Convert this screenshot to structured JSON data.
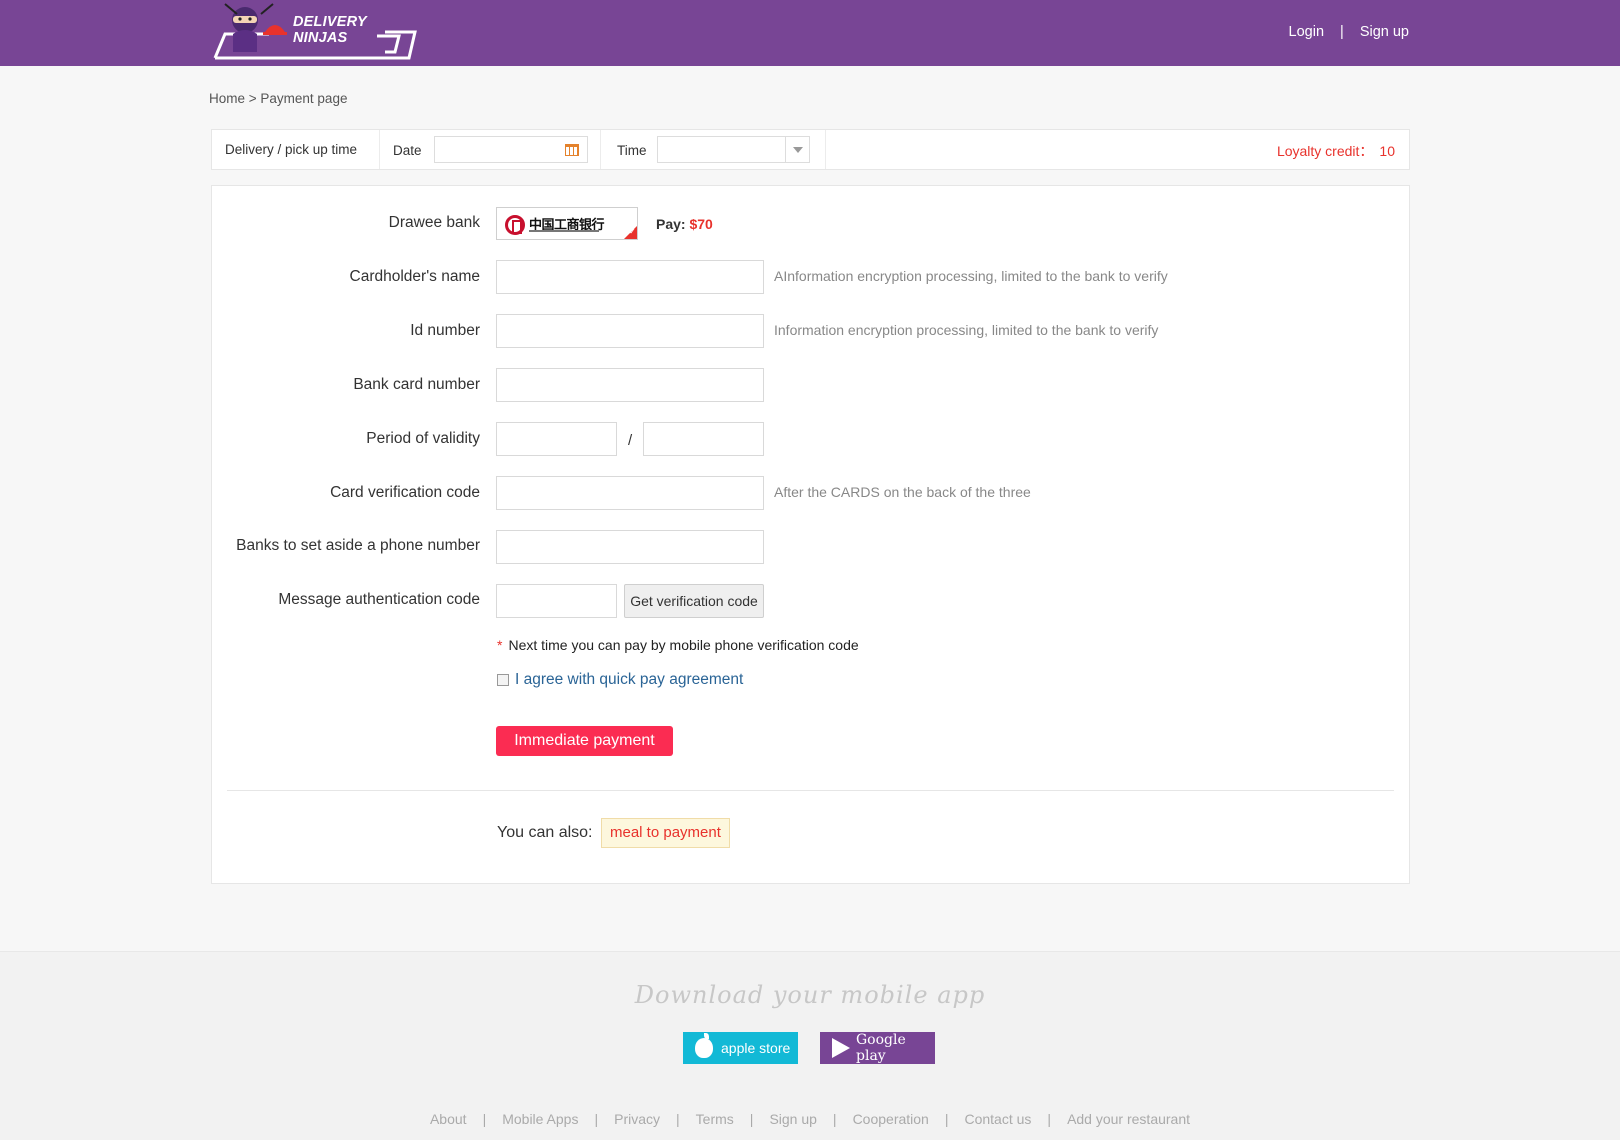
{
  "header": {
    "logo_text": "DELIVERY NINJAS",
    "login": "Login",
    "separator": "|",
    "signup": "Sign up"
  },
  "breadcrumb": "Home > Payment page",
  "timebar": {
    "label": "Delivery / pick up time",
    "date_label": "Date",
    "date_value": "",
    "time_label": "Time",
    "time_value": "",
    "loyalty_label": "Loyalty credit：",
    "loyalty_value": "10"
  },
  "form": {
    "drawee_bank_label": "Drawee bank",
    "bank_name": "中国工商银行",
    "pay_label": "Pay:",
    "pay_amount": "$70",
    "cardholder_label": "Cardholder's name",
    "cardholder_hint": "AInformation encryption processing, limited to the bank to verify",
    "id_label": "Id number",
    "id_hint": "Information encryption processing, limited to the bank to verify",
    "card_number_label": "Bank card number",
    "validity_label": "Period of validity",
    "validity_sep": "/",
    "cvc_label": "Card verification code",
    "cvc_hint": "After the CARDS on the back of the three",
    "phone_label": "Banks to set aside a phone number",
    "sms_label": "Message authentication code",
    "get_code_button": "Get verification code",
    "note_star": "*",
    "note": "Next time you can pay by mobile phone verification code",
    "agree": "I agree with quick pay agreement",
    "agree_checked": false,
    "submit": "Immediate payment",
    "also_label": "You can also:",
    "meal_button": "meal to payment"
  },
  "footer": {
    "download_title": "Download your mobile app",
    "apple_store": "apple store",
    "google_play": "Google play",
    "links": [
      "About",
      "Mobile Apps",
      "Privacy",
      "Terms",
      "Sign up",
      "Cooperation",
      "Contact us",
      "Add your restaurant"
    ],
    "link_sep": "|"
  },
  "colors": {
    "header_bg": "#784595",
    "accent_red": "#fb2c52",
    "apple_btn": "#12b9d6",
    "google_btn": "#784595"
  }
}
